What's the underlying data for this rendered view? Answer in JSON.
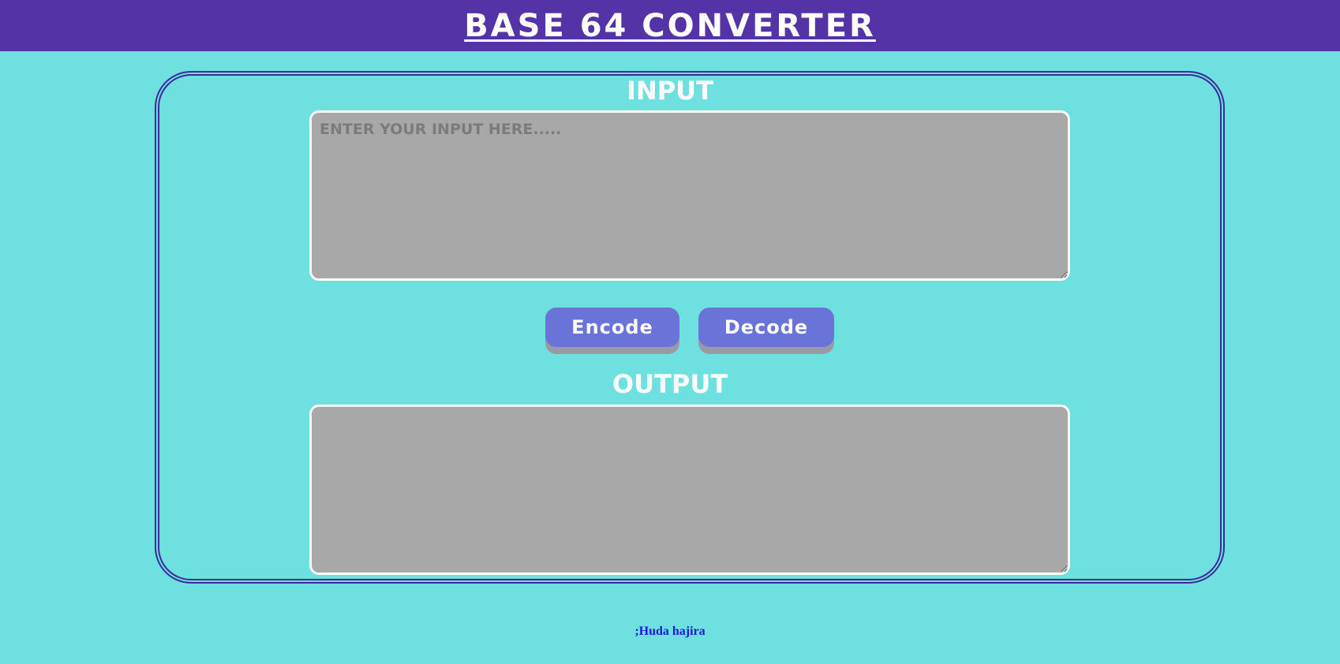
{
  "header": {
    "title": "BASE 64 CONVERTER"
  },
  "input_section": {
    "title": "INPUT",
    "placeholder": "ENTER YOUR INPUT HERE.....",
    "value": ""
  },
  "buttons": {
    "encode_label": "Encode",
    "decode_label": "Decode"
  },
  "output_section": {
    "title": "OUTPUT",
    "value": ""
  },
  "footer": {
    "text": ";Huda hajira"
  },
  "colors": {
    "header_bg": "#5333a6",
    "page_bg": "#6fe0e0",
    "button_bg": "#6a74d8",
    "textarea_bg": "#a8a8a8",
    "panel_border": "#3b2a9a",
    "footer_text": "#1a1ad6"
  }
}
